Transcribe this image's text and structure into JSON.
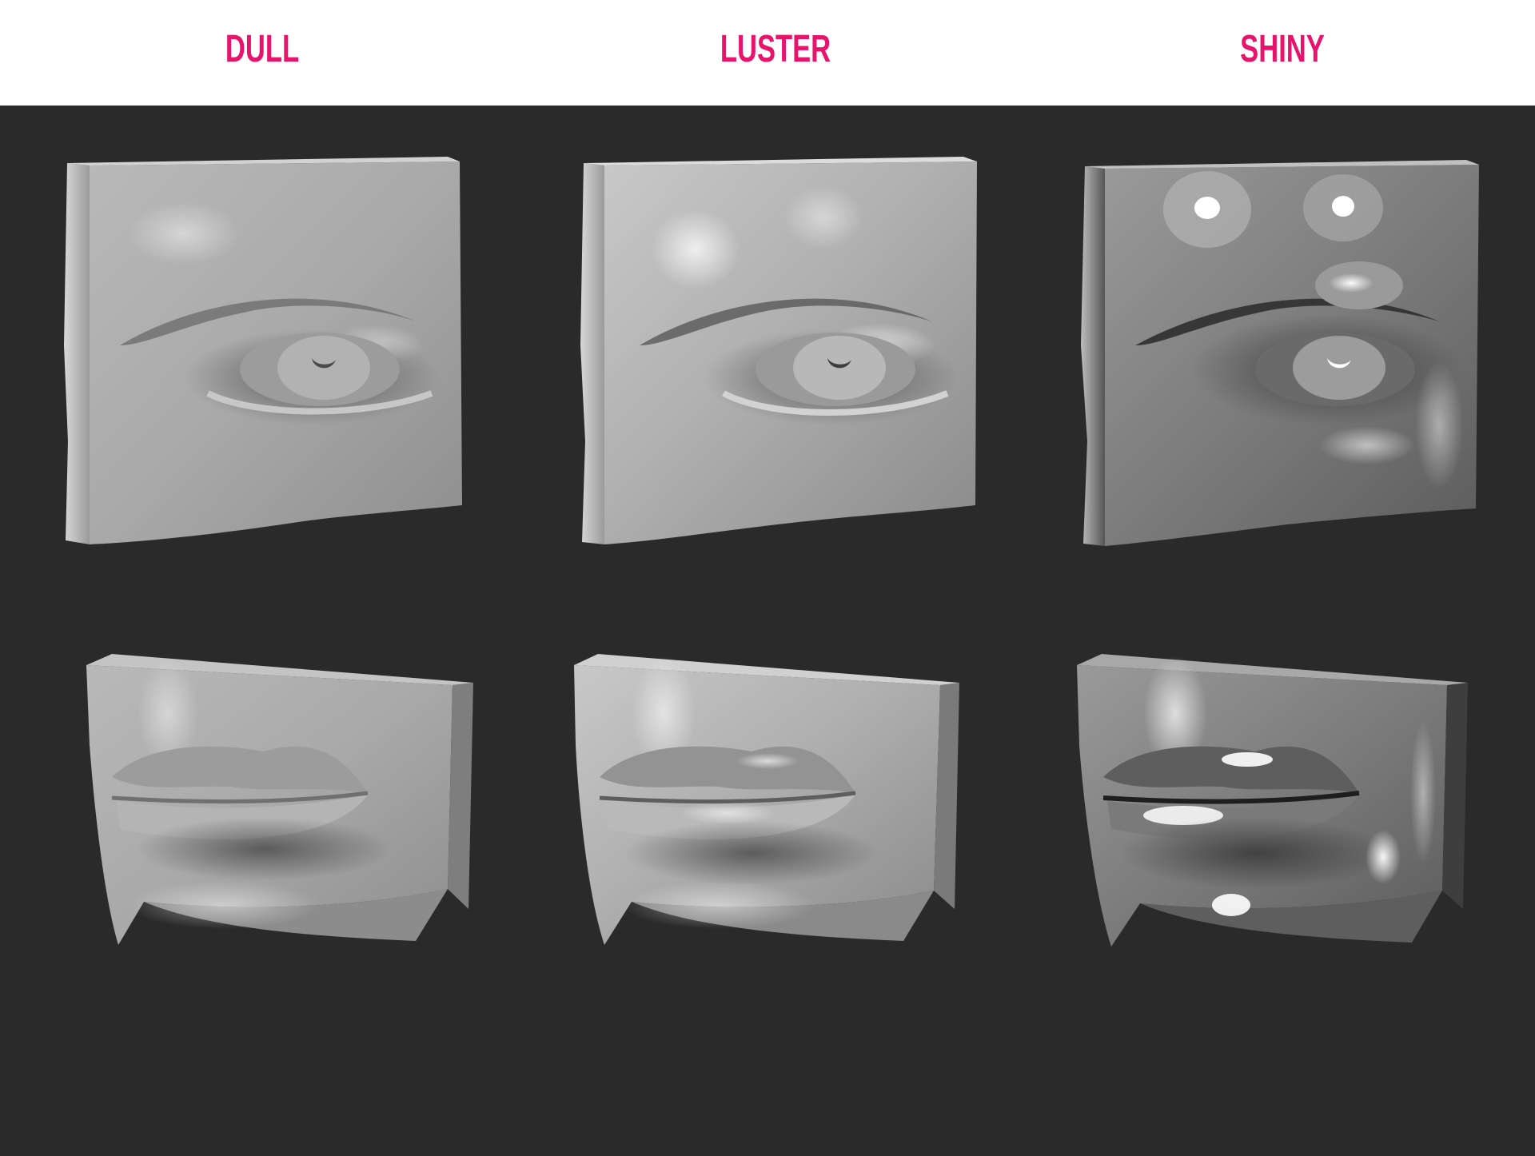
{
  "header": {
    "columns": [
      {
        "label": "DULL"
      },
      {
        "label": "LUSTER"
      },
      {
        "label": "SHINY"
      }
    ],
    "label_color": "#e8146c"
  },
  "panel": {
    "background_color": "#2a2a2a",
    "rows": [
      "eye",
      "mouth"
    ],
    "finishes": [
      "dull",
      "luster",
      "shiny"
    ]
  }
}
